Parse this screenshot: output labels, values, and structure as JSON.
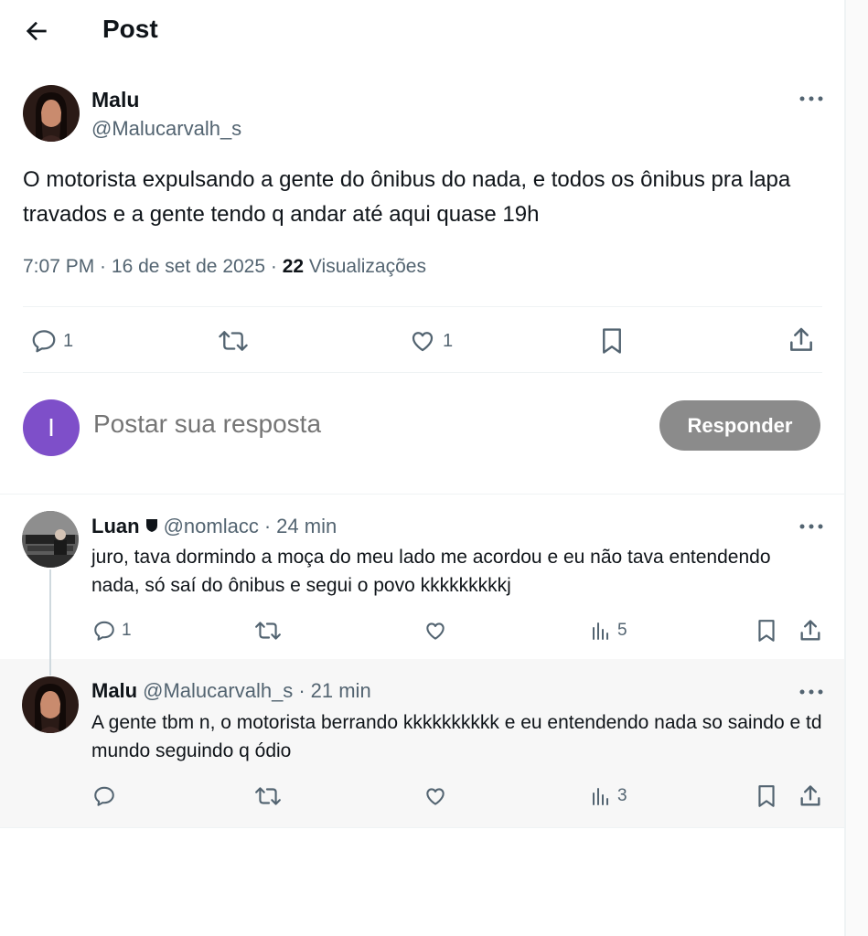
{
  "header": {
    "title": "Post"
  },
  "post": {
    "name": "Malu",
    "handle": "@Malucarvalh_s",
    "text": "O motorista expulsando a gente do ônibus do nada, e todos os ônibus pra lapa travados e a gente tendo q andar até aqui quase 19h",
    "time": "7:07 PM",
    "date": "16 de set de 2025",
    "views_count": "22",
    "views_label": "Visualizações",
    "actions": {
      "replies": "1",
      "reposts": "",
      "likes": "1"
    }
  },
  "compose": {
    "avatar_letter": "I",
    "placeholder": "Postar sua resposta",
    "button_label": "Responder"
  },
  "replies": [
    {
      "name": "Luan",
      "handle": "@nomlacc",
      "time": "24 min",
      "text": "juro, tava dormindo a moça do meu lado me acordou e eu não tava entendendo nada, só saí do ônibus e segui o povo kkkkkkkkkj",
      "actions": {
        "replies": "1",
        "reposts": "",
        "likes": "",
        "views": "5"
      }
    },
    {
      "name": "Malu",
      "handle": "@Malucarvalh_s",
      "time": "21 min",
      "text": "A gente tbm n, o motorista berrando kkkkkkkkkk e eu entendendo nada so saindo e td mundo seguindo q ódio",
      "actions": {
        "replies": "",
        "reposts": "",
        "likes": "",
        "views": "3"
      }
    }
  ],
  "colors": {
    "text": "#0f1419",
    "muted": "#536471",
    "border": "#eff3f4",
    "highlight_bg": "#f7f7f7",
    "compose_avatar": "#7e4fc9",
    "button_disabled": "#8b8b8b"
  },
  "icons": [
    "back-arrow-icon",
    "more-icon",
    "reply-icon",
    "repost-icon",
    "like-icon",
    "bookmark-icon",
    "share-icon",
    "views-icon",
    "shield-badge-icon"
  ]
}
